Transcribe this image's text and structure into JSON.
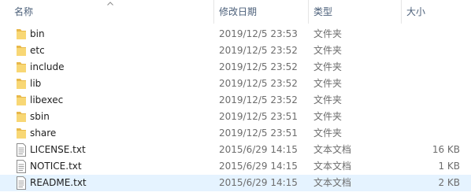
{
  "header": {
    "columns": {
      "name": "名称",
      "date": "修改日期",
      "type": "类型",
      "size": "大小"
    },
    "sort_indicator": "chevron-up-icon"
  },
  "files": [
    {
      "name": "bin",
      "date": "2019/12/5 23:53",
      "type": "文件夹",
      "size": "",
      "icon": "folder-icon"
    },
    {
      "name": "etc",
      "date": "2019/12/5 23:52",
      "type": "文件夹",
      "size": "",
      "icon": "folder-icon"
    },
    {
      "name": "include",
      "date": "2019/12/5 23:52",
      "type": "文件夹",
      "size": "",
      "icon": "folder-icon"
    },
    {
      "name": "lib",
      "date": "2019/12/5 23:52",
      "type": "文件夹",
      "size": "",
      "icon": "folder-icon"
    },
    {
      "name": "libexec",
      "date": "2019/12/5 23:52",
      "type": "文件夹",
      "size": "",
      "icon": "folder-icon"
    },
    {
      "name": "sbin",
      "date": "2019/12/5 23:51",
      "type": "文件夹",
      "size": "",
      "icon": "folder-icon"
    },
    {
      "name": "share",
      "date": "2019/12/5 23:51",
      "type": "文件夹",
      "size": "",
      "icon": "folder-icon"
    },
    {
      "name": "LICENSE.txt",
      "date": "2015/6/29 14:15",
      "type": "文本文档",
      "size": "16 KB",
      "icon": "text-file-icon"
    },
    {
      "name": "NOTICE.txt",
      "date": "2015/6/29 14:15",
      "type": "文本文档",
      "size": "1 KB",
      "icon": "text-file-icon"
    },
    {
      "name": "README.txt",
      "date": "2015/6/29 14:15",
      "type": "文本文档",
      "size": "2 KB",
      "icon": "text-file-icon",
      "selected": true
    }
  ],
  "colors": {
    "header_text": "#4c607a",
    "folder": "#f8d775",
    "folder_dark": "#e8b84a",
    "selection": "#e5f3ff"
  }
}
